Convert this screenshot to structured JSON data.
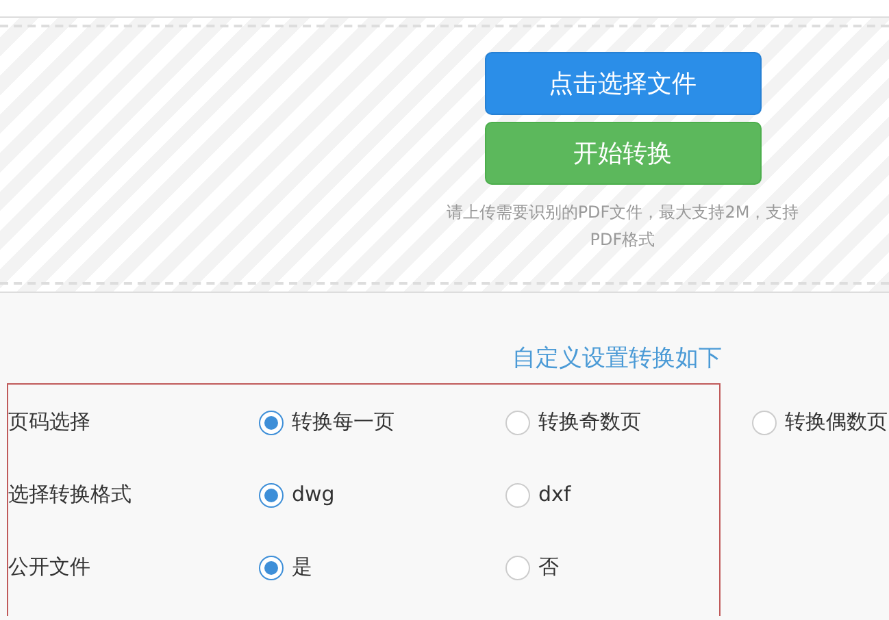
{
  "upload": {
    "buttons": [
      {
        "label": "点击选择文件",
        "kind": "primary"
      },
      {
        "label": "开始转换",
        "kind": "success"
      }
    ],
    "hint": "请上传需要识别的PDF文件，最大支持2M，支持PDF格式"
  },
  "settings": {
    "title": "自定义设置转换如下",
    "rows": [
      {
        "label": "页码选择",
        "options": [
          {
            "label": "转换每一页",
            "selected": true
          },
          {
            "label": "转换奇数页",
            "selected": false
          },
          {
            "label": "转换偶数页",
            "selected": false
          }
        ]
      },
      {
        "label": "选择转换格式",
        "options": [
          {
            "label": "dwg",
            "selected": true
          },
          {
            "label": "dxf",
            "selected": false
          }
        ]
      },
      {
        "label": "公开文件",
        "options": [
          {
            "label": "是",
            "selected": true
          },
          {
            "label": "否",
            "selected": false
          }
        ]
      }
    ]
  }
}
